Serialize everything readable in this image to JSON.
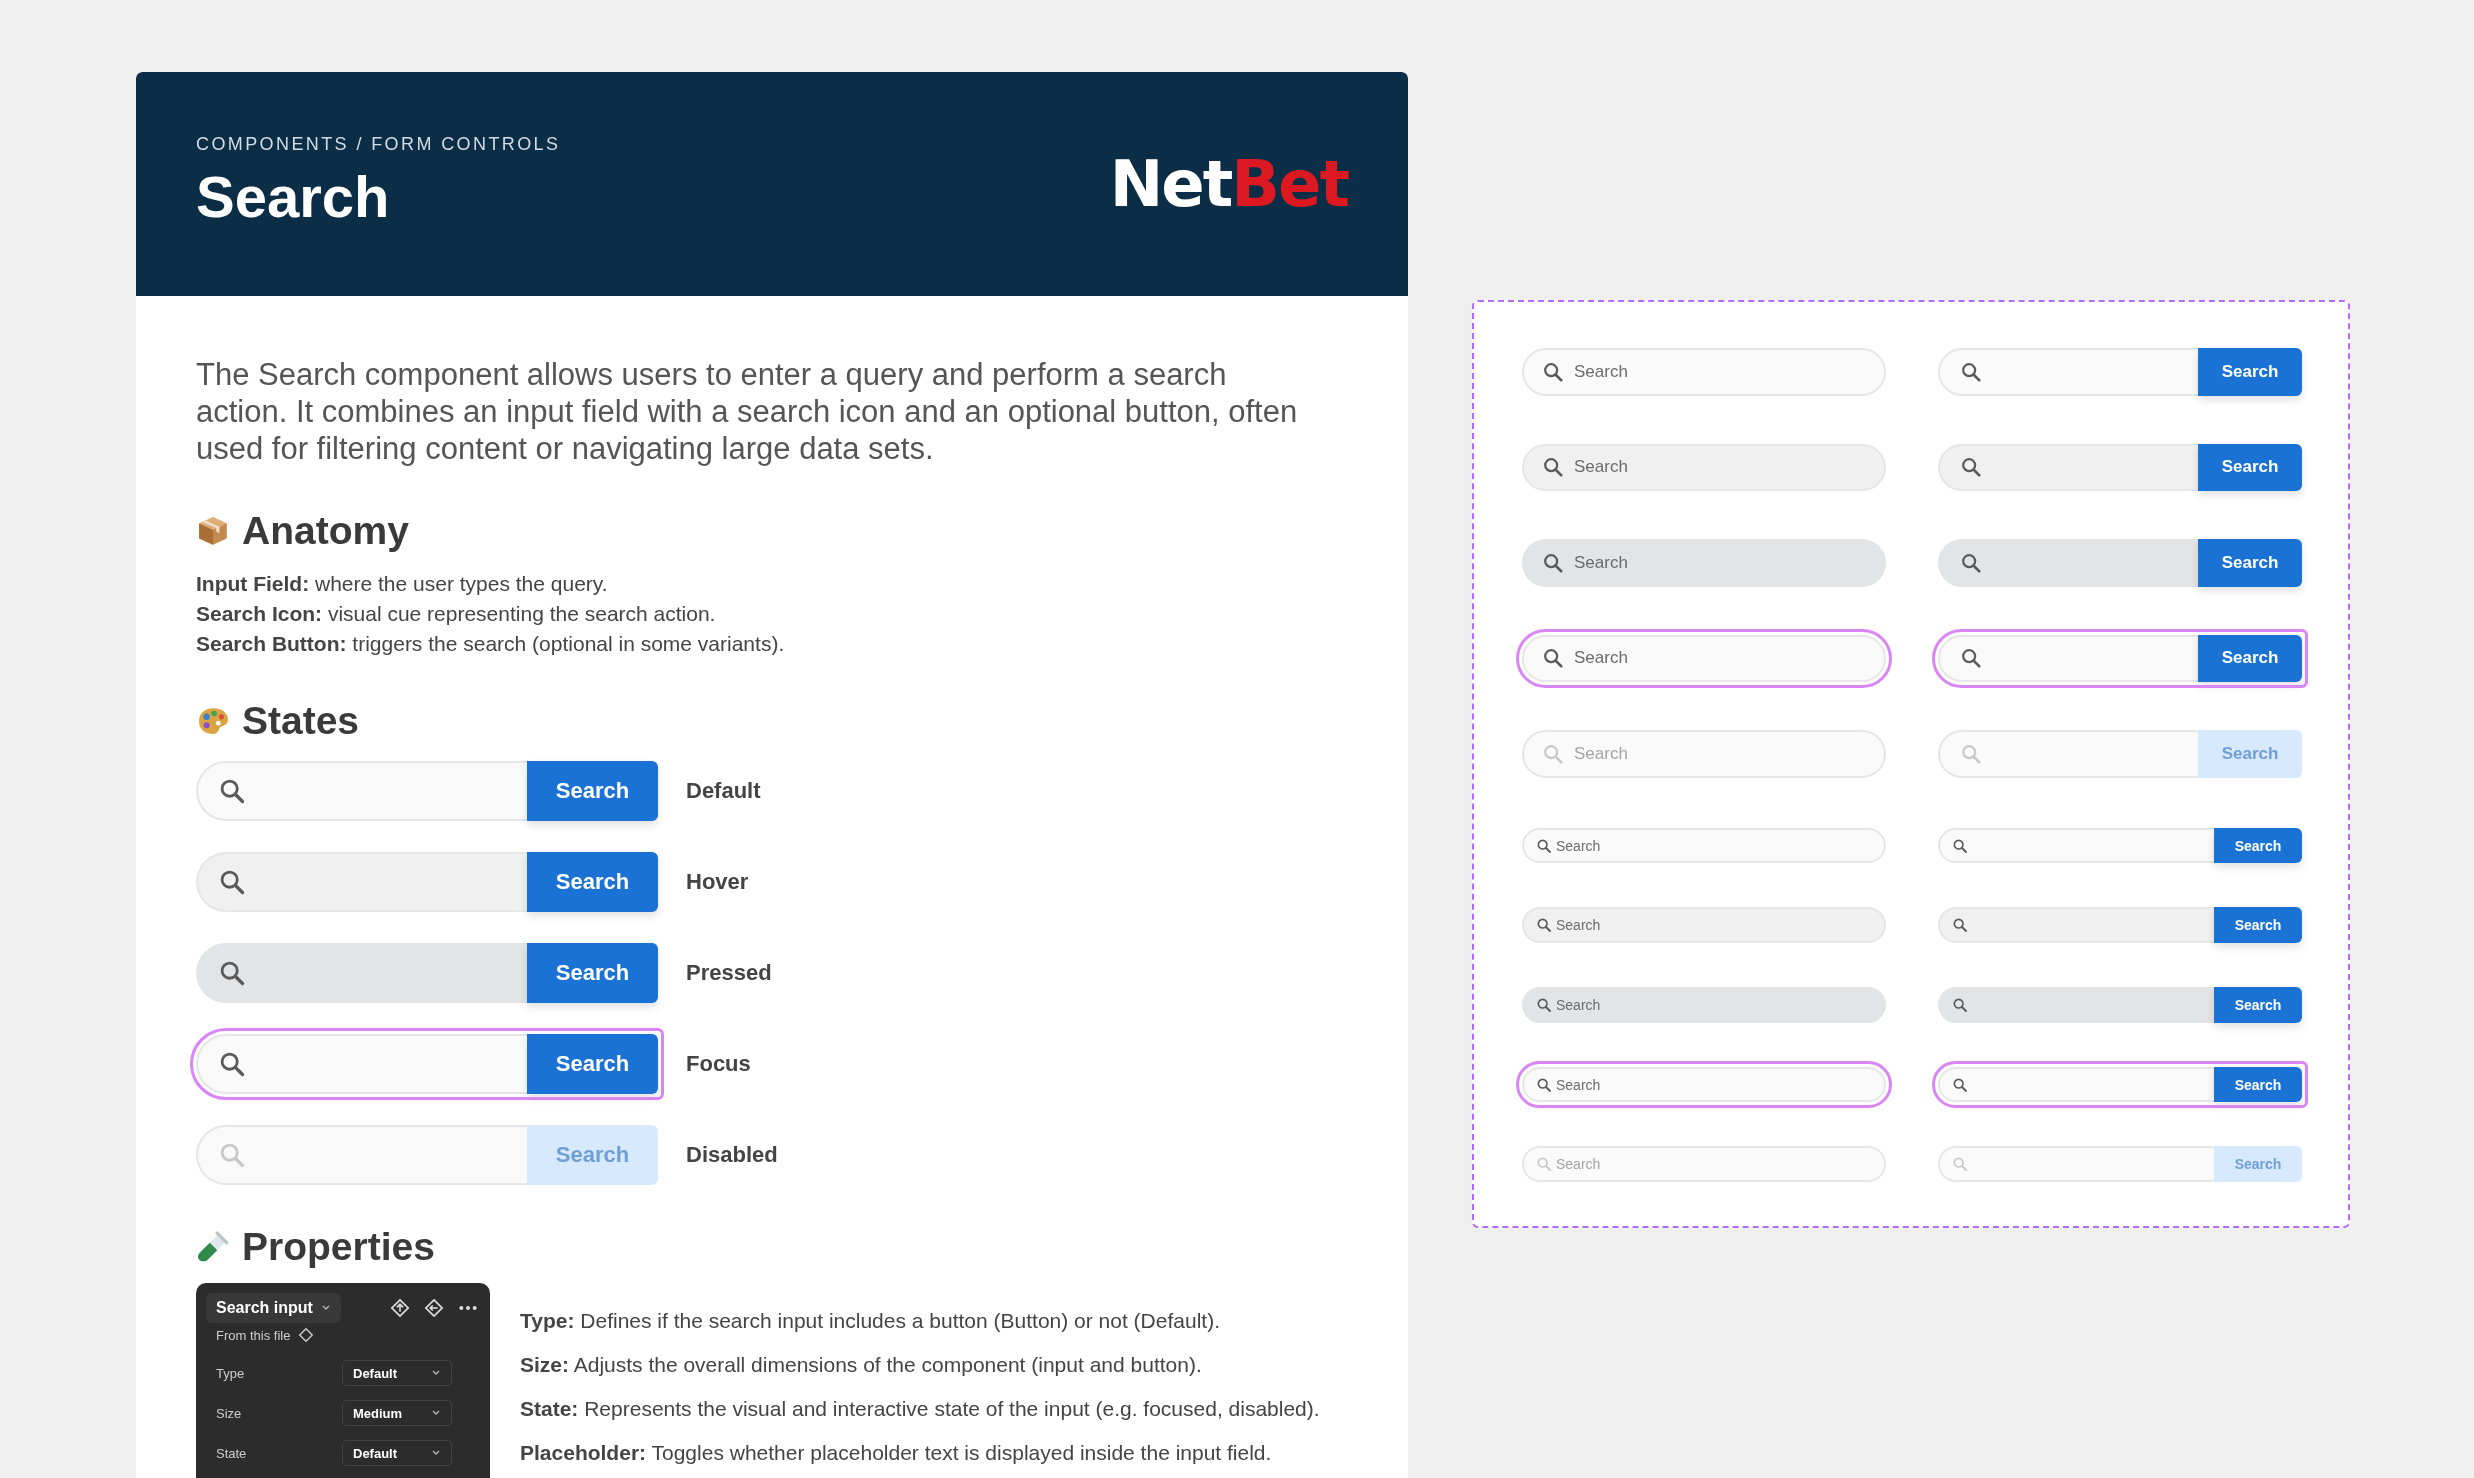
{
  "header": {
    "breadcrumb": "COMPONENTS / FORM CONTROLS",
    "title": "Search",
    "logo": [
      "Net",
      "Bet"
    ]
  },
  "intro": "The Search component allows users to enter a query and perform a search action. It combines an input field with a search icon and an optional button, often used for filtering content or navigating large data sets.",
  "anatomy": {
    "heading": "Anatomy",
    "items": [
      "**Input Field:** where the user types the query.",
      "**Search Icon:** visual cue representing the search action.",
      "**Search Button:** triggers the search (optional in some variants)."
    ]
  },
  "states": {
    "heading": "States",
    "rows": [
      {
        "kind": "default",
        "button": "Search",
        "label": "Default"
      },
      {
        "kind": "hover",
        "button": "Search",
        "label": "Hover"
      },
      {
        "kind": "pressed",
        "button": "Search",
        "label": "Pressed"
      },
      {
        "kind": "focus",
        "button": "Search",
        "label": "Focus"
      },
      {
        "kind": "disabled",
        "button": "Search",
        "label": "Disabled"
      }
    ]
  },
  "properties": {
    "heading": "Properties",
    "panel": {
      "title": "Search input",
      "subtitle": "From this file",
      "rows": [
        {
          "name": "Type",
          "value": "Default"
        },
        {
          "name": "Size",
          "value": "Medium"
        },
        {
          "name": "State",
          "value": "Default"
        }
      ]
    },
    "descriptions": [
      "**Type:** Defines if the search input includes a button (Button) or not (Default).",
      "**Size:** Adjusts the overall dimensions of the component (input and button).",
      "**State:** Represents the visual and interactive state of the input (e.g. focused, disabled).",
      "**Placeholder:** Toggles whether placeholder text is displayed inside the input field."
    ]
  },
  "variants": {
    "medium": [
      {
        "kind": "default",
        "placeholder": "Search",
        "button": "Search"
      },
      {
        "kind": "hover",
        "placeholder": "Search",
        "button": "Search"
      },
      {
        "kind": "pressed",
        "placeholder": "Search",
        "button": "Search"
      },
      {
        "kind": "focus",
        "placeholder": "Search",
        "button": "Search"
      },
      {
        "kind": "disabled",
        "placeholder": "Search",
        "button": "Search"
      }
    ],
    "small": [
      {
        "kind": "default",
        "placeholder": "Search",
        "button": "Search"
      },
      {
        "kind": "hover",
        "placeholder": "Search",
        "button": "Search"
      },
      {
        "kind": "pressed",
        "placeholder": "Search",
        "button": "Search"
      },
      {
        "kind": "focus",
        "placeholder": "Search",
        "button": "Search"
      },
      {
        "kind": "disabled",
        "placeholder": "Search",
        "button": "Search"
      }
    ]
  }
}
